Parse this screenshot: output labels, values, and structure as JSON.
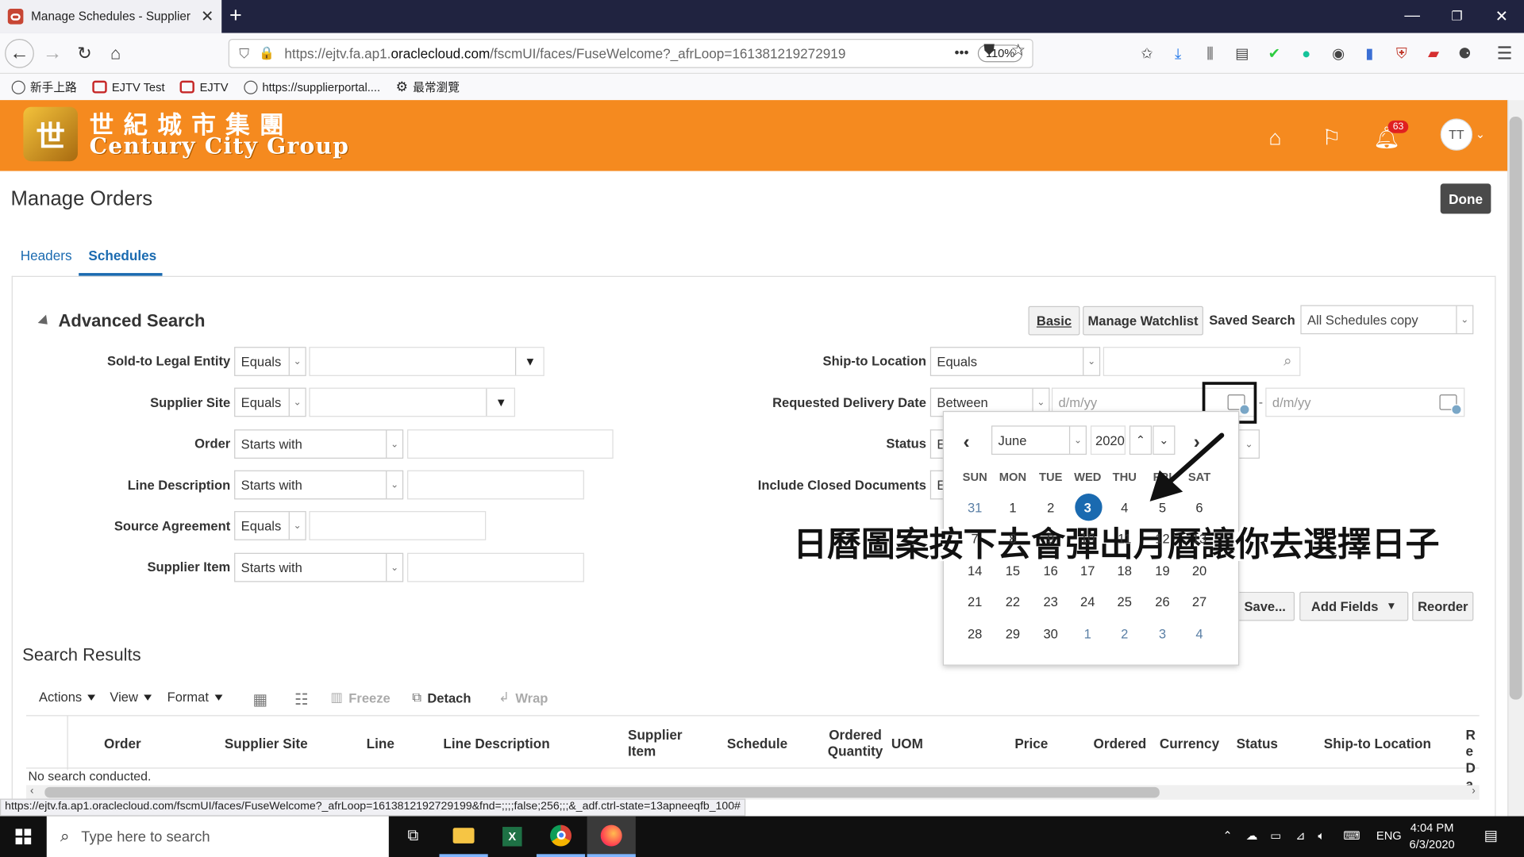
{
  "browser": {
    "tab_title": "Manage Schedules - Supplier P",
    "new_tab": "+",
    "url_prefix": "https://ejtv.fa.ap1.",
    "url_domain": "oraclecloud.com",
    "url_rest": "/fscmUI/faces/FuseWelcome?_afrLoop=161381219272919",
    "zoom": "110%",
    "more": "•••",
    "status_url": "https://ejtv.fa.ap1.oraclecloud.com/fscmUI/faces/FuseWelcome?_afrLoop=1613812192729199&fnd=;;;;false;256;;;&_adf.ctrl-state=13apneeqfb_100#"
  },
  "bookmarks": [
    "新手上路",
    "EJTV Test",
    "EJTV",
    "https://supplierportal....",
    "最常瀏覽"
  ],
  "app": {
    "logo_cn": "世紀城市集團",
    "logo_en": "Century City Group",
    "notifications_count": "63",
    "avatar": "TT"
  },
  "page": {
    "title": "Manage Orders",
    "done": "Done",
    "tabs": [
      "Headers",
      "Schedules"
    ],
    "active_tab": "Schedules"
  },
  "search": {
    "title": "Advanced Search",
    "basic": "Basic",
    "manage_watchlist": "Manage Watchlist",
    "saved_search_label": "Saved Search",
    "saved_search_value": "All Schedules copy",
    "fields": {
      "sold_to": {
        "label": "Sold-to Legal Entity",
        "op": "Equals"
      },
      "supplier_site": {
        "label": "Supplier Site",
        "op": "Equals"
      },
      "order": {
        "label": "Order",
        "op": "Starts with"
      },
      "line_description": {
        "label": "Line Description",
        "op": "Starts with"
      },
      "source_agreement": {
        "label": "Source Agreement",
        "op": "Equals"
      },
      "supplier_item": {
        "label": "Supplier Item",
        "op": "Starts with"
      },
      "ship_to": {
        "label": "Ship-to Location",
        "op": "Equals"
      },
      "requested_delivery": {
        "label": "Requested Delivery Date",
        "op": "Between",
        "placeholder": "d/m/yy",
        "dash": "-"
      },
      "status": {
        "label": "Status",
        "op": "E"
      },
      "include_closed": {
        "label": "Include Closed Documents",
        "op": "E"
      }
    },
    "save": "Save...",
    "add_fields": "Add Fields",
    "reorder": "Reorder"
  },
  "calendar": {
    "month": "June",
    "year": "2020",
    "weekdays": [
      "SUN",
      "MON",
      "TUE",
      "WED",
      "THU",
      "FRI",
      "SAT"
    ],
    "weeks": [
      [
        "31",
        "1",
        "2",
        "3",
        "4",
        "5",
        "6"
      ],
      [
        "7",
        "8",
        "9",
        "10",
        "11",
        "12",
        "13"
      ],
      [
        "14",
        "15",
        "16",
        "17",
        "18",
        "19",
        "20"
      ],
      [
        "21",
        "22",
        "23",
        "24",
        "25",
        "26",
        "27"
      ],
      [
        "28",
        "29",
        "30",
        "1",
        "2",
        "3",
        "4"
      ]
    ],
    "today": "3"
  },
  "annotation": "日曆圖案按下去會彈出月曆讓你去選擇日子",
  "results": {
    "title": "Search Results",
    "toolbar": {
      "actions": "Actions",
      "view": "View",
      "format": "Format",
      "freeze": "Freeze",
      "detach": "Detach",
      "wrap": "Wrap"
    },
    "columns": [
      "Order",
      "Supplier Site",
      "Line",
      "Line Description",
      "Supplier Item",
      "Schedule",
      "Ordered Quantity",
      "UOM",
      "Price",
      "Ordered",
      "Currency",
      "Status",
      "Ship-to Location",
      "Re Da"
    ],
    "empty": "No search conducted."
  },
  "taskbar": {
    "search_placeholder": "Type here to search",
    "lang": "ENG",
    "time": "4:04 PM",
    "date": "6/3/2020"
  },
  "colors": {
    "header_orange": "#f58a1f",
    "link_blue": "#1a6ab0",
    "browser_tabbar": "#202340"
  }
}
